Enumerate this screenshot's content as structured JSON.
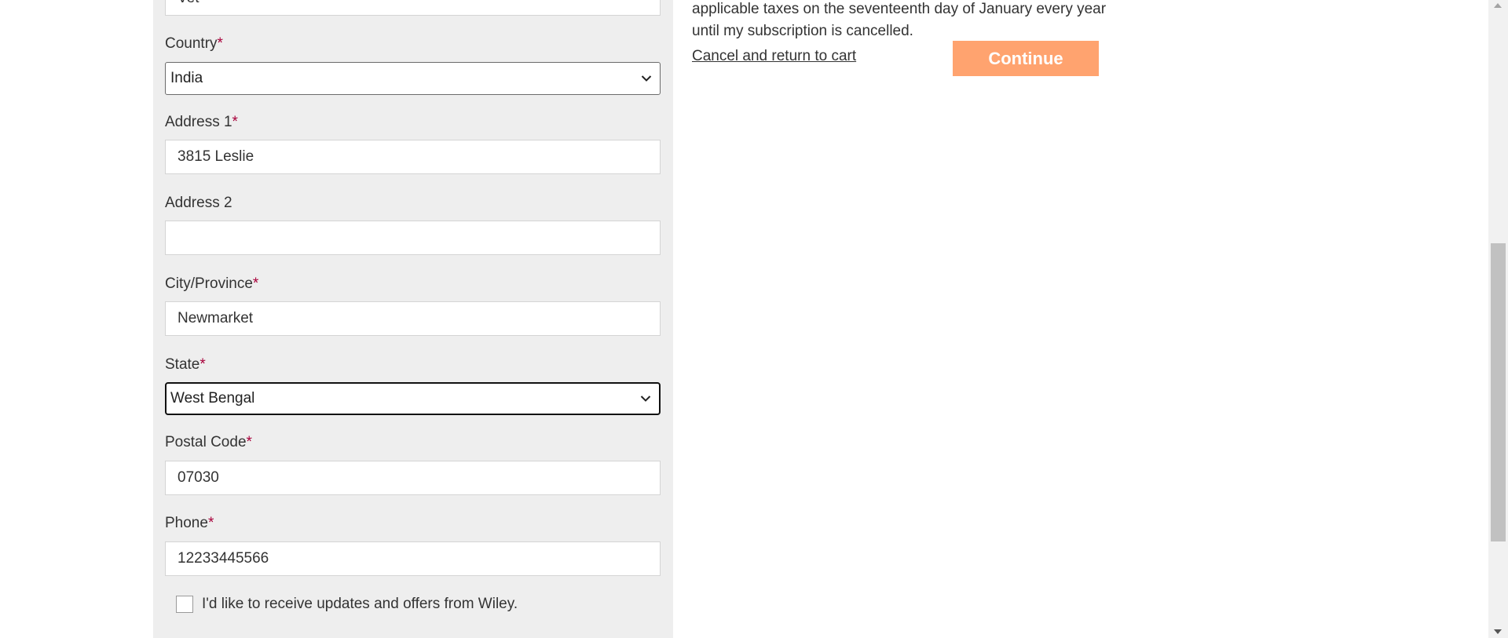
{
  "form": {
    "top_partial_value": "Vet",
    "required_mark": "*",
    "country": {
      "label": "Country",
      "value": "India"
    },
    "address1": {
      "label": "Address 1",
      "value": "3815 Leslie"
    },
    "address2": {
      "label": "Address 2",
      "value": ""
    },
    "city": {
      "label": "City/Province",
      "value": "Newmarket"
    },
    "state": {
      "label": "State",
      "value": "West Bengal"
    },
    "postal": {
      "label": "Postal Code",
      "value": "07030"
    },
    "phone": {
      "label": "Phone",
      "value": "12233445566"
    },
    "updates_opt_in": {
      "label": "I'd like to receive updates and offers from Wiley.",
      "checked": false
    }
  },
  "summary": {
    "terms_line1": "applicable taxes on the seventeenth day of January every year",
    "terms_line2": "until my subscription is cancelled.",
    "cancel_link": "Cancel and return to cart",
    "continue_button": "Continue"
  },
  "colors": {
    "panel_bg": "#eeeeee",
    "required": "#a8003a",
    "continue_bg": "#ffa36f"
  }
}
